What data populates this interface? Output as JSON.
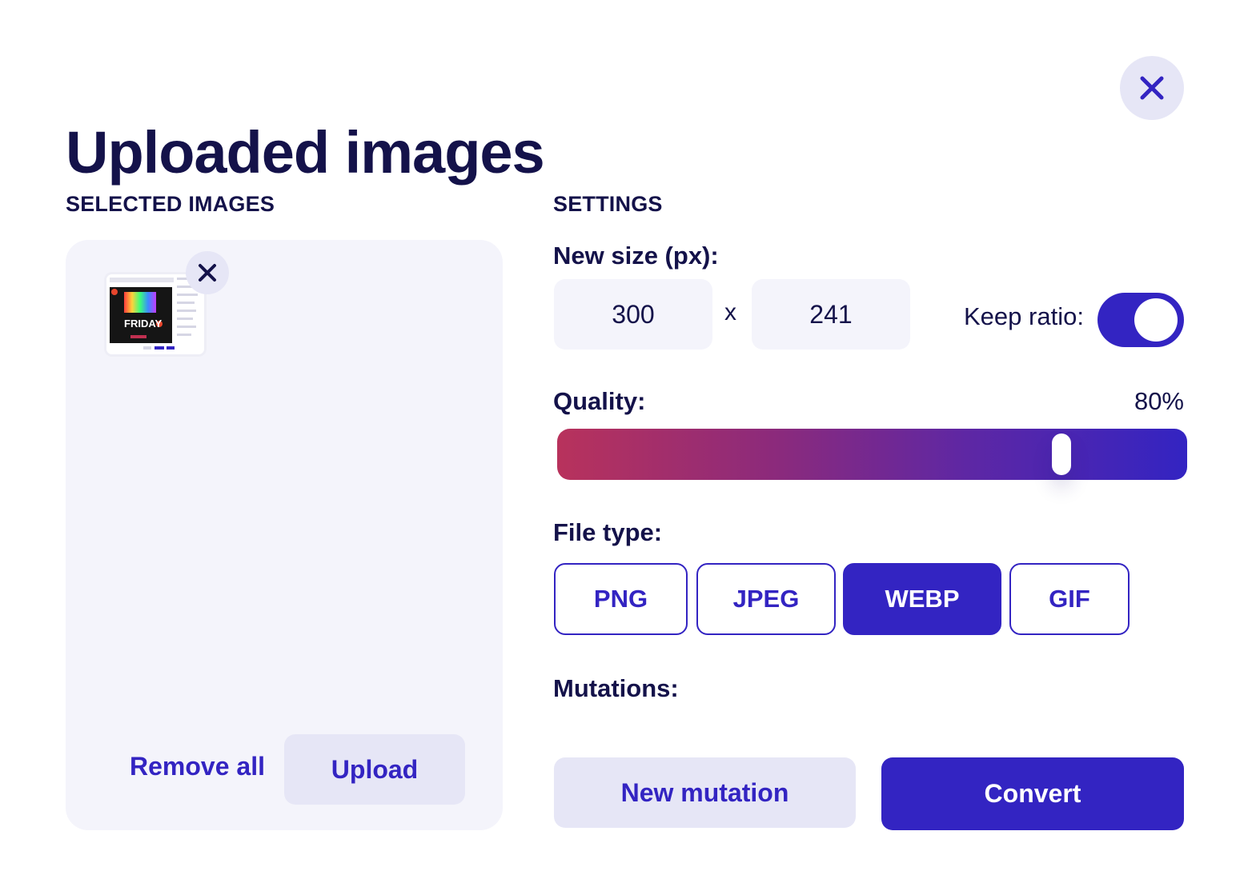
{
  "dialog": {
    "title": "Uploaded images",
    "close_icon": "close-icon"
  },
  "selected_images": {
    "label": "SELECTED IMAGES",
    "items": [
      {
        "thumbnail_text": "FRIDAY",
        "remove_icon": "close-icon"
      }
    ],
    "remove_all_label": "Remove all",
    "upload_label": "Upload"
  },
  "settings": {
    "label": "SETTINGS",
    "new_size": {
      "label": "New size (px):",
      "width": "300",
      "separator": "x",
      "height": "241"
    },
    "keep_ratio": {
      "label": "Keep ratio:",
      "on": true
    },
    "quality": {
      "label": "Quality:",
      "value_text": "80%",
      "value": 80
    },
    "file_type": {
      "label": "File type:",
      "options": [
        "PNG",
        "JPEG",
        "WEBP",
        "GIF"
      ],
      "selected": "WEBP"
    },
    "mutations": {
      "label": "Mutations:"
    },
    "new_mutation_label": "New mutation",
    "convert_label": "Convert"
  },
  "colors": {
    "accent": "#3324c2",
    "text_dark": "#14124a",
    "panel_bg": "#f4f4fb",
    "soft_button_bg": "#e6e6f6",
    "gradient_start": "#b8325c",
    "gradient_end": "#3324c2"
  }
}
